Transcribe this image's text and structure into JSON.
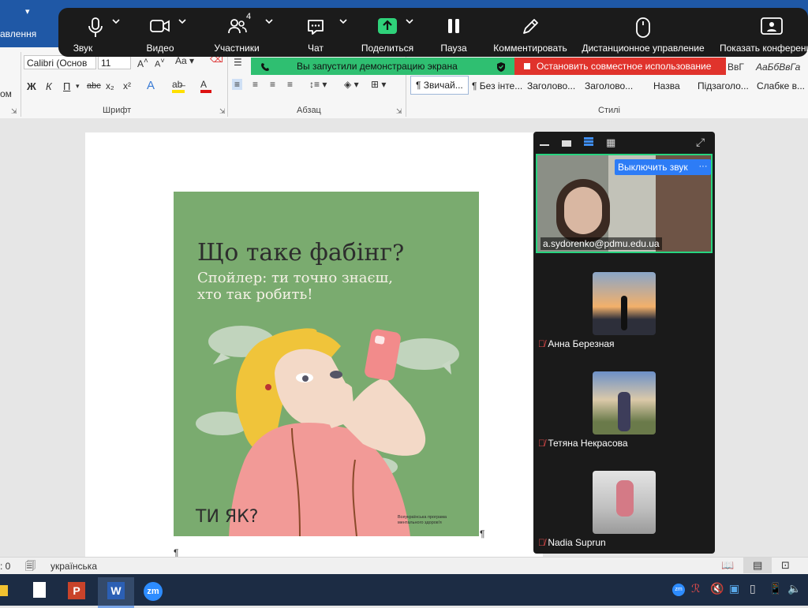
{
  "word": {
    "left_tab": "авлення",
    "left_cut": "ом",
    "font_name": "Calibri (Основ",
    "font_size": "11",
    "grp_font": "Шрифт",
    "grp_paragraph": "Абзац",
    "grp_styles": "Стилі",
    "styles": [
      "¶ Звичай...",
      "¶ Без інте...",
      "Заголово...",
      "Заголово...",
      "Назва",
      "Підзаголо...",
      "Слабке в..."
    ],
    "style_previews": [
      "ВвГ",
      "АаБбВвГа"
    ],
    "fmt_buttons": [
      "Ж",
      "К",
      "П",
      "abc",
      "x₂",
      "x²"
    ],
    "pilcrow": "¶"
  },
  "zoom_toolbar": {
    "items": [
      {
        "label": "Звук",
        "icon": "microphone-icon"
      },
      {
        "label": "Видео",
        "icon": "video-camera-icon"
      },
      {
        "label": "Участники",
        "icon": "participants-icon",
        "badge": "4"
      },
      {
        "label": "Чат",
        "icon": "chat-icon"
      },
      {
        "label": "Поделиться",
        "icon": "share-arrow-icon"
      },
      {
        "label": "Пауза",
        "icon": "pause-icon"
      },
      {
        "label": "Комментировать",
        "icon": "pencil-icon"
      },
      {
        "label": "Дистанционное управление",
        "icon": "mouse-icon"
      },
      {
        "label": "Показать конференц",
        "icon": "show-conference-icon"
      }
    ],
    "share_notice": "Вы запустили демонстрацию экрана",
    "stop_share": "Остановить совместное использование"
  },
  "poster": {
    "title": "Що таке фабінг",
    "subtitle_line1": "Спойлер: ти точно знаєш,",
    "subtitle_line2": "хто так робить!",
    "brand": "ТИ ЯК",
    "program_line1": "Всеукраїнська програма",
    "program_line2": "ментального здоров'я"
  },
  "zoom_panel": {
    "mute_button": "Выключить звук",
    "more_button": "···",
    "active_speaker": "a.sydorenko@pdmu.edu.ua",
    "participants": [
      {
        "name": "Анна Березная",
        "muted": true
      },
      {
        "name": "Тетяна Некрасова",
        "muted": true
      },
      {
        "name": "Nadia Suprun",
        "muted": true
      }
    ]
  },
  "status": {
    "words": ": 0",
    "language": "українська"
  },
  "taskbar": {
    "apps": [
      "file-explorer",
      "blank-document",
      "powerpoint",
      "word",
      "zoom"
    ],
    "zoom_label": "zm"
  },
  "colors": {
    "word_blue": "#1f58a6",
    "zoom_green": "#2fbf71",
    "zoom_red": "#e0332c",
    "poster_green": "#7aab6f",
    "speaker_border": "#27d47f"
  }
}
